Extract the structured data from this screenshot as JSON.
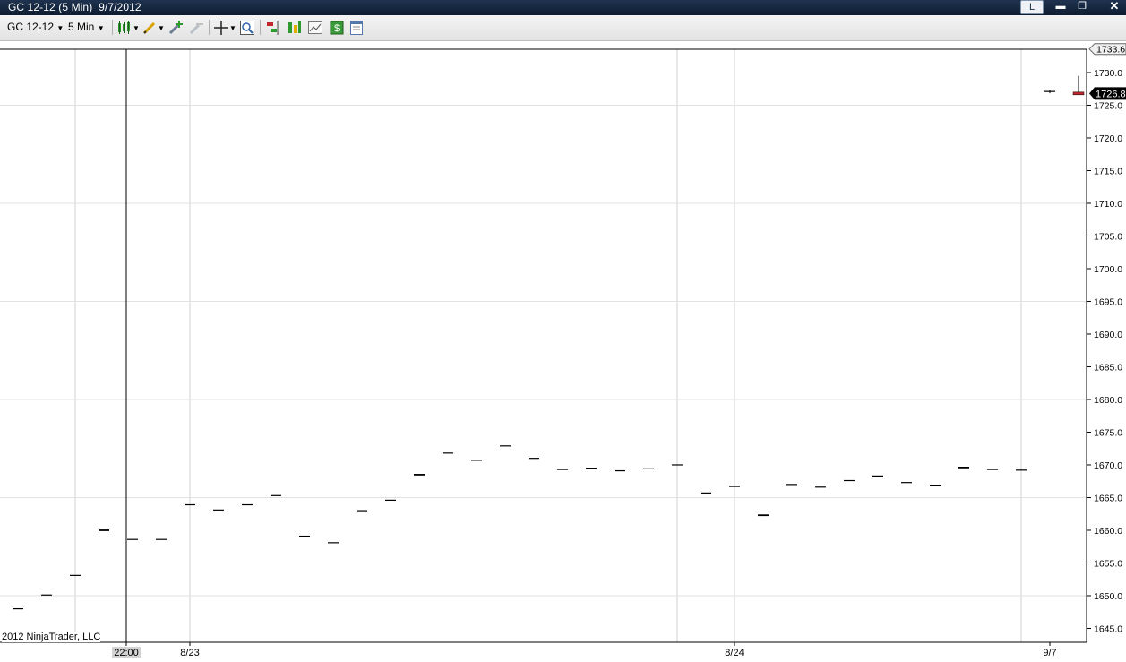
{
  "window": {
    "title": "GC 12-12 (5 Min)  9/7/2012",
    "l_button": "L"
  },
  "toolbar": {
    "instrument": "GC 12-12",
    "interval": "5 Min",
    "icons": [
      "candlestick-chart-icon",
      "pencil-draw-icon",
      "add-indicator-icon",
      "remove-indicator-icon",
      "crosshair-icon",
      "zoom-icon",
      "order-entry-icon",
      "strategy-icon",
      "chart-style-icon",
      "dollar-icon",
      "properties-icon"
    ]
  },
  "chart_data": {
    "type": "bar",
    "title": "",
    "ylim": [
      1644,
      1734
    ],
    "y_ticks": [
      "1645.0",
      "1650.0",
      "1655.0",
      "1660.0",
      "1665.0",
      "1670.0",
      "1675.0",
      "1680.0",
      "1685.0",
      "1690.0",
      "1695.0",
      "1700.0",
      "1705.0",
      "1710.0",
      "1715.0",
      "1720.0",
      "1725.0",
      "1730.0"
    ],
    "top_marker": "1733.6",
    "last_price": "1726.8",
    "x_labels": [
      "22:00",
      "8/23",
      "8/24",
      "9/7"
    ],
    "bars": [
      {
        "value": 1648.0
      },
      {
        "value": 1650.1
      },
      {
        "value": 1653.1
      },
      {
        "value": 1660.0
      },
      {
        "value": 1658.6
      },
      {
        "value": 1658.6
      },
      {
        "value": 1663.9
      },
      {
        "value": 1663.1
      },
      {
        "value": 1663.9
      },
      {
        "value": 1665.3
      },
      {
        "value": 1659.1
      },
      {
        "value": 1658.1
      },
      {
        "value": 1663.0
      },
      {
        "value": 1664.6
      },
      {
        "value": 1668.5
      },
      {
        "value": 1671.8
      },
      {
        "value": 1670.7
      },
      {
        "value": 1672.9
      },
      {
        "value": 1671.0
      },
      {
        "value": 1669.3
      },
      {
        "value": 1669.5
      },
      {
        "value": 1669.1
      },
      {
        "value": 1669.4
      },
      {
        "value": 1670.0
      },
      {
        "value": 1665.7
      },
      {
        "value": 1666.7
      },
      {
        "value": 1662.3
      },
      {
        "value": 1667.0
      },
      {
        "value": 1666.6
      },
      {
        "value": 1667.6
      },
      {
        "value": 1668.3
      },
      {
        "value": 1667.3
      },
      {
        "value": 1666.9
      },
      {
        "value": 1669.6
      },
      {
        "value": 1669.3
      },
      {
        "value": 1669.2
      },
      {
        "value": 1727.1
      },
      {
        "value": 1726.8
      }
    ],
    "last_bar_high": 1729.5,
    "copyright": "2012 NinjaTrader, LLC",
    "colors": {
      "bar": "#000000",
      "last_bar": "#c0262c",
      "grid": "#d8d8d8"
    }
  }
}
